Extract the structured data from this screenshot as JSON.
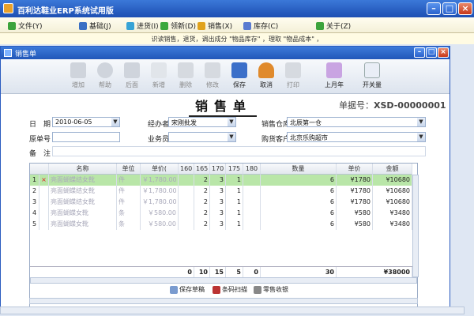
{
  "window": {
    "title": "百利达鞋业ERP系统试用版"
  },
  "menus": [
    {
      "label": "文件(Y)",
      "icon": "file-icon",
      "color": "#3ca33c"
    },
    {
      "label": "基础(J)",
      "icon": "base-icon",
      "color": "#3a6fc4"
    },
    {
      "label": "进货(I)",
      "icon": "purchase-icon",
      "color": "#37a3d6"
    },
    {
      "label": "领新(D)",
      "icon": "refresh-icon",
      "color": "#3aa83a"
    },
    {
      "label": "销售(X)",
      "icon": "sales-icon",
      "color": "#e0a21c"
    },
    {
      "label": "库存(C)",
      "icon": "stock-icon",
      "color": "#5a7bd0"
    },
    {
      "label": "关于(Z)",
      "icon": "about-icon",
      "color": "#3ca33c"
    }
  ],
  "statusline": "识读销售，退货，调出成分 \"物品库存\" ，理取 \"物品成本\" ，",
  "child": {
    "title": "销售单"
  },
  "toolbar": [
    {
      "label": "增加",
      "icon": "arrow-left-icon",
      "enabled": false
    },
    {
      "label": "帮助",
      "icon": "help-icon",
      "enabled": false
    },
    {
      "label": "后面",
      "icon": "arrow-right-icon",
      "enabled": false
    },
    {
      "label": "新增",
      "icon": "new-icon",
      "enabled": false
    },
    {
      "label": "删除",
      "icon": "delete-icon",
      "enabled": false
    },
    {
      "label": "修改",
      "icon": "edit-icon",
      "enabled": false
    },
    {
      "label": "保存",
      "icon": "save-icon",
      "enabled": true
    },
    {
      "label": "取消",
      "icon": "undo-icon",
      "enabled": true
    },
    {
      "label": "打印",
      "icon": "print-icon",
      "enabled": false
    },
    {
      "label": "上月年",
      "icon": "calc-icon",
      "enabled": true
    },
    {
      "label": "开关量",
      "icon": "list-icon",
      "enabled": true
    }
  ],
  "doc": {
    "title": "销售单",
    "number_label": "单据号：",
    "number": "XSD-00000001"
  },
  "form": {
    "date_label": "日　期",
    "date": "2010-06-05",
    "handler_label": "经办者",
    "handler": "宋刚批发",
    "warehouse_label": "销售仓库",
    "warehouse": "北辰第一仓",
    "orig_label": "原单号",
    "orig": "",
    "staff_label": "业务员",
    "staff": "",
    "customer_label": "购货客户",
    "customer": "北京乐购超市",
    "memo_label": "备　注",
    "memo": ""
  },
  "grid": {
    "headers": [
      "",
      "名称",
      "单位",
      "单价(",
      "160",
      "165",
      "170",
      "175",
      "180",
      "数量",
      "单价",
      "金额"
    ],
    "rows": [
      {
        "idx": "1",
        "mark": "×",
        "name": "亮面蝴蝶结女靴",
        "unit": "件",
        "price": "￥1,780.00",
        "s160": "",
        "s165": "2",
        "s170": "3",
        "s175": "1",
        "s180": "",
        "qty": "6",
        "uprice": "¥1780",
        "amount": "¥10680"
      },
      {
        "idx": "2",
        "mark": "",
        "name": "亮面蝴蝶结女靴",
        "unit": "件",
        "price": "￥1,780.00",
        "s160": "",
        "s165": "2",
        "s170": "3",
        "s175": "1",
        "s180": "",
        "qty": "6",
        "uprice": "¥1780",
        "amount": "¥10680"
      },
      {
        "idx": "3",
        "mark": "",
        "name": "亮面蝴蝶结女靴",
        "unit": "件",
        "price": "￥1,780.00",
        "s160": "",
        "s165": "2",
        "s170": "3",
        "s175": "1",
        "s180": "",
        "qty": "6",
        "uprice": "¥1780",
        "amount": "¥10680"
      },
      {
        "idx": "4",
        "mark": "",
        "name": "亮面蝴蝶女靴",
        "unit": "条",
        "price": "￥580.00",
        "s160": "",
        "s165": "2",
        "s170": "3",
        "s175": "1",
        "s180": "",
        "qty": "6",
        "uprice": "¥580",
        "amount": "¥3480"
      },
      {
        "idx": "5",
        "mark": "",
        "name": "亮面蝴蝶女靴",
        "unit": "条",
        "price": "￥580.00",
        "s160": "",
        "s165": "2",
        "s170": "3",
        "s175": "1",
        "s180": "",
        "qty": "6",
        "uprice": "¥580",
        "amount": "¥3480"
      }
    ],
    "totals": {
      "s160": "0",
      "s165": "10",
      "s170": "15",
      "s175": "5",
      "s180": "0",
      "qty": "30",
      "amount": "¥38000"
    }
  },
  "bottom": [
    {
      "label": "保存草稿",
      "icon": "draft-icon"
    },
    {
      "label": "条码扫描",
      "icon": "barcode-icon"
    },
    {
      "label": "零售收银",
      "icon": "cash-icon"
    }
  ]
}
